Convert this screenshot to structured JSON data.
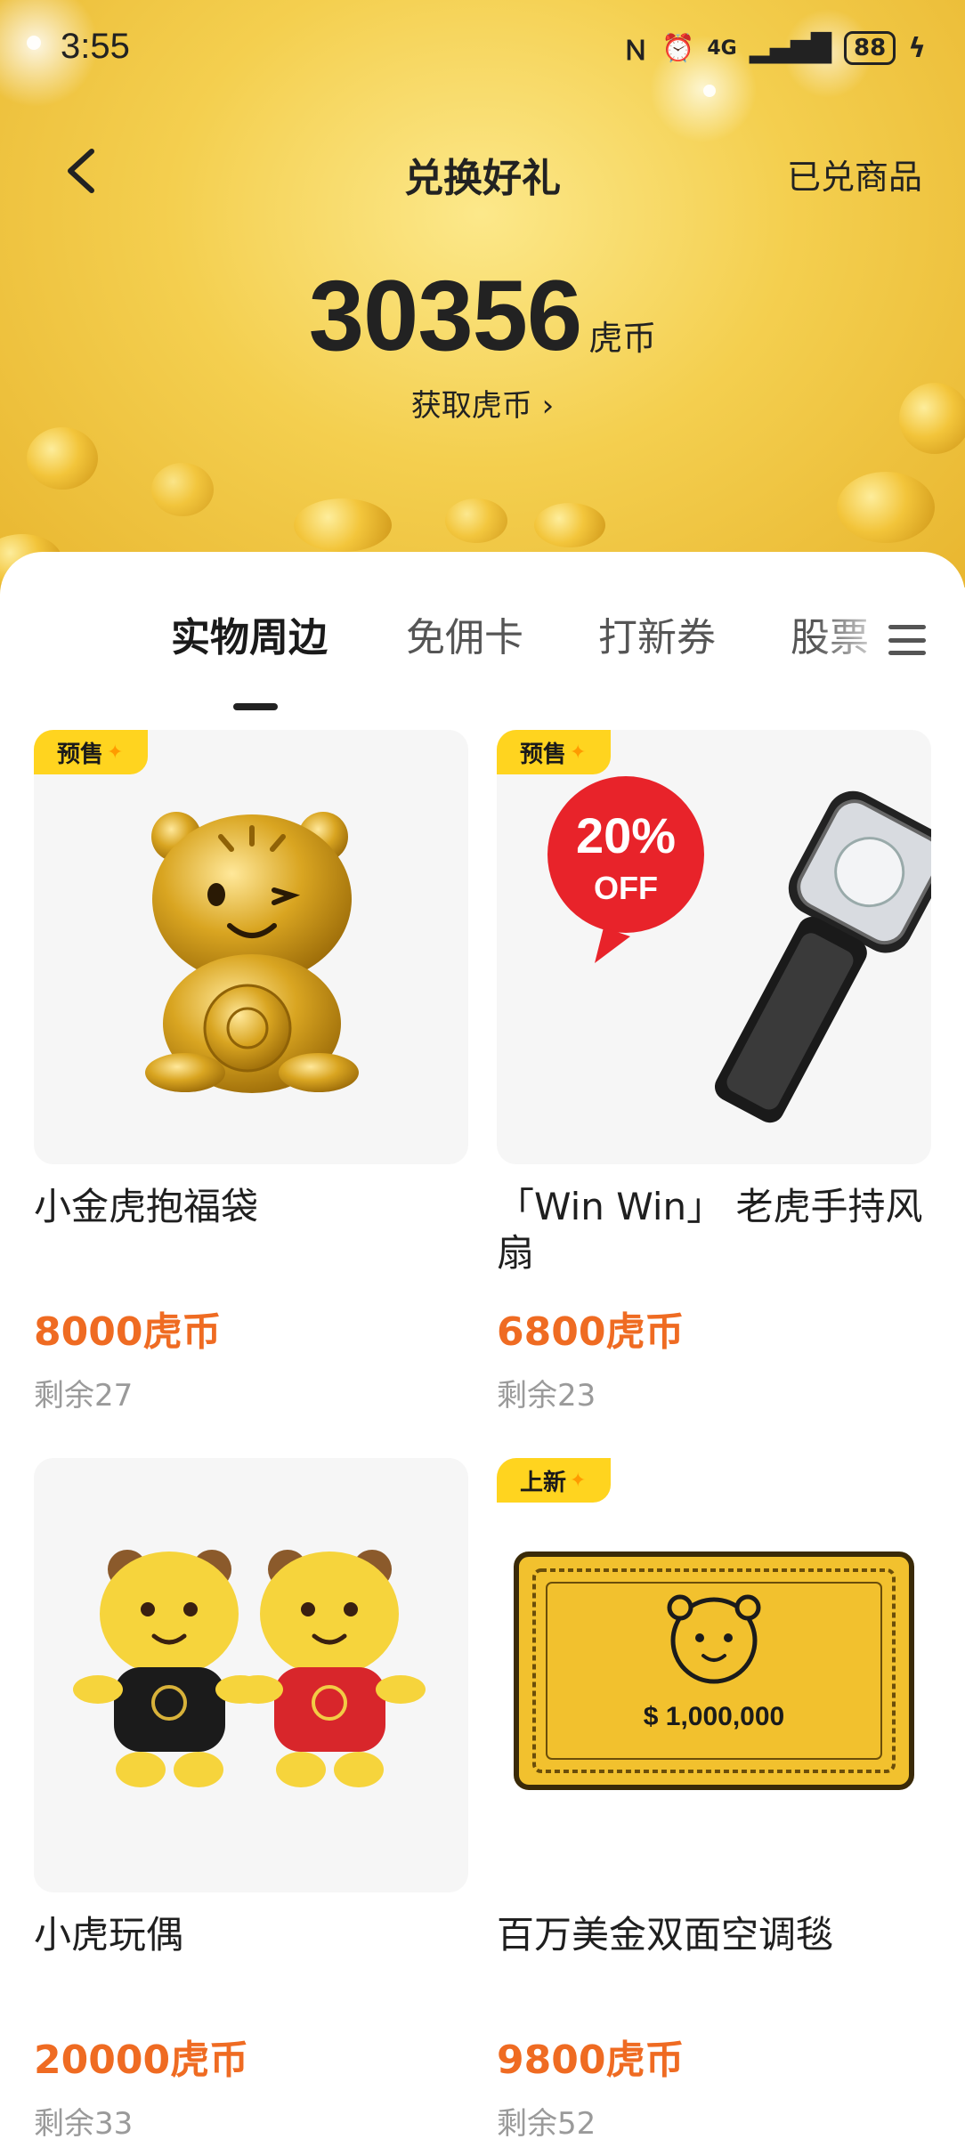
{
  "status_bar": {
    "time": "3:55",
    "signal": "4G",
    "battery": "88"
  },
  "header": {
    "title": "兑换好礼",
    "right_link": "已兑商品",
    "balance": "30356",
    "balance_unit": "虎币",
    "get_coins": "获取虎币 ›"
  },
  "tabs": [
    {
      "label": "实物周边",
      "active": true
    },
    {
      "label": "免佣卡",
      "active": false
    },
    {
      "label": "打新券",
      "active": false
    },
    {
      "label": "股票",
      "active": false
    }
  ],
  "products": [
    {
      "name": "小金虎抱福袋",
      "price": "8000虎币",
      "stock": "剩余27",
      "badge": "预售"
    },
    {
      "name": "「Win Win」 老虎手持风扇",
      "price": "6800虎币",
      "stock": "剩余23",
      "badge": "预售",
      "promo_top": "20%",
      "promo_bottom": "OFF"
    },
    {
      "name": "小虎玩偶",
      "price": "20000虎币",
      "stock": "剩余33",
      "badge": ""
    },
    {
      "name": "百万美金双面空调毯",
      "price": "9800虎币",
      "stock": "剩余52",
      "badge": "上新",
      "blanket_text": "$ 1,000,000"
    }
  ],
  "colors": {
    "accent_price": "#ef6b22",
    "badge_bg": "#ffd41f",
    "gold": "#f4cf4f"
  }
}
